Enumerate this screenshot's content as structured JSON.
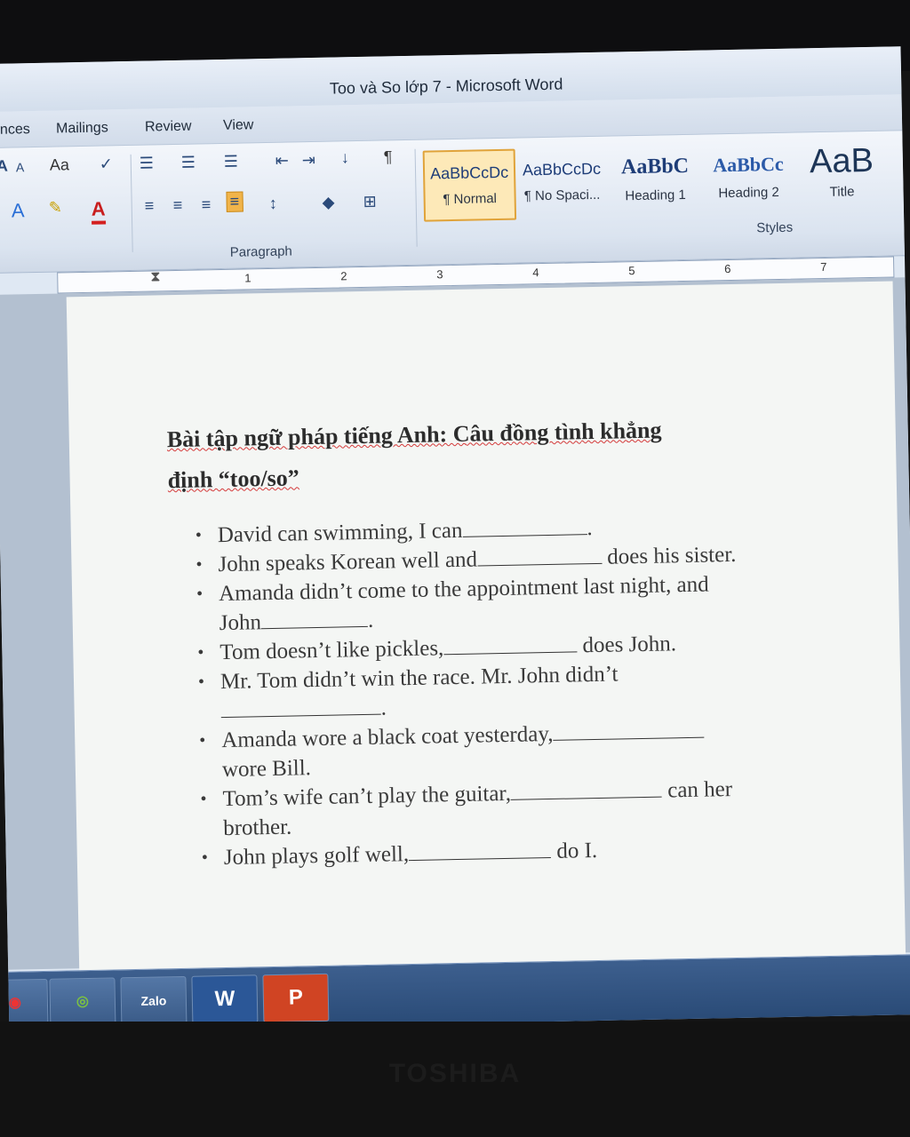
{
  "window": {
    "title": "Too và So lớp 7 - Microsoft Word"
  },
  "ribbon_tabs": [
    "ences",
    "Mailings",
    "Review",
    "View"
  ],
  "ribbon": {
    "paragraph_group_label": "Paragraph",
    "styles_group_label": "Styles",
    "styles": [
      {
        "sample": "AaBbCcDc",
        "name": "¶ Normal",
        "selected": true
      },
      {
        "sample": "AaBbCcDc",
        "name": "¶ No Spaci...",
        "selected": false
      },
      {
        "sample": "AaBbC",
        "name": "Heading 1",
        "selected": false
      },
      {
        "sample": "AaBbCc",
        "name": "Heading 2",
        "selected": false
      },
      {
        "sample": "AaB",
        "name": "Title",
        "selected": false
      }
    ],
    "font_buttons": {
      "grow": "A",
      "shrink": "A",
      "change_case": "Aa",
      "font_color": "A"
    },
    "icons": [
      "grow-font-icon",
      "shrink-font-icon",
      "change-case-icon",
      "spelling-icon",
      "bullets-icon",
      "numbering-icon",
      "multilevel-list-icon",
      "decrease-indent-icon",
      "increase-indent-icon",
      "sort-icon",
      "show-formatting-icon",
      "text-effects-icon",
      "highlight-icon",
      "font-color-icon",
      "align-left-icon",
      "center-icon",
      "align-right-icon",
      "justify-icon",
      "line-spacing-icon",
      "shading-icon",
      "borders-icon"
    ]
  },
  "ruler": {
    "numbers": [
      "1",
      "2",
      "3",
      "4",
      "5",
      "6",
      "7"
    ]
  },
  "document": {
    "title_line1": "Bài tập ngữ pháp tiếng Anh: Câu đồng tình khẳng",
    "title_line2": "định “too/so”",
    "items": [
      {
        "before": "David can swimming, I can",
        "after": "."
      },
      {
        "before": "John speaks Korean well and",
        "after": "does his sister."
      },
      {
        "before": "Amanda didn’t come to the appointment last night, and John",
        "after": "."
      },
      {
        "before": "Tom doesn’t like pickles,",
        "after": "does John."
      },
      {
        "before": "Mr. Tom didn’t win the race. Mr. John didn’t",
        "after": "."
      },
      {
        "before": "Amanda wore a black coat yesterday,",
        "after": "wore Bill."
      },
      {
        "before": "Tom’s wife can’t play the guitar,",
        "after": "can her brother."
      },
      {
        "before": "John plays golf well,",
        "after": "do I."
      }
    ]
  },
  "taskbar": {
    "apps": [
      {
        "name": "chrome-icon",
        "label": ""
      },
      {
        "name": "coccoc-icon",
        "label": ""
      },
      {
        "name": "zalo-icon",
        "label": "Zalo"
      },
      {
        "name": "word-icon",
        "label": "W"
      },
      {
        "name": "powerpoint-icon",
        "label": "P"
      }
    ]
  },
  "monitor_brand": "TOSHIBA",
  "colors": {
    "ribbon": "#dbe4f0",
    "selected_style": "#fde9b8",
    "heading_style": "#1e3d78",
    "taskbar": "#294a76",
    "spell_error": "#d43a3a"
  }
}
